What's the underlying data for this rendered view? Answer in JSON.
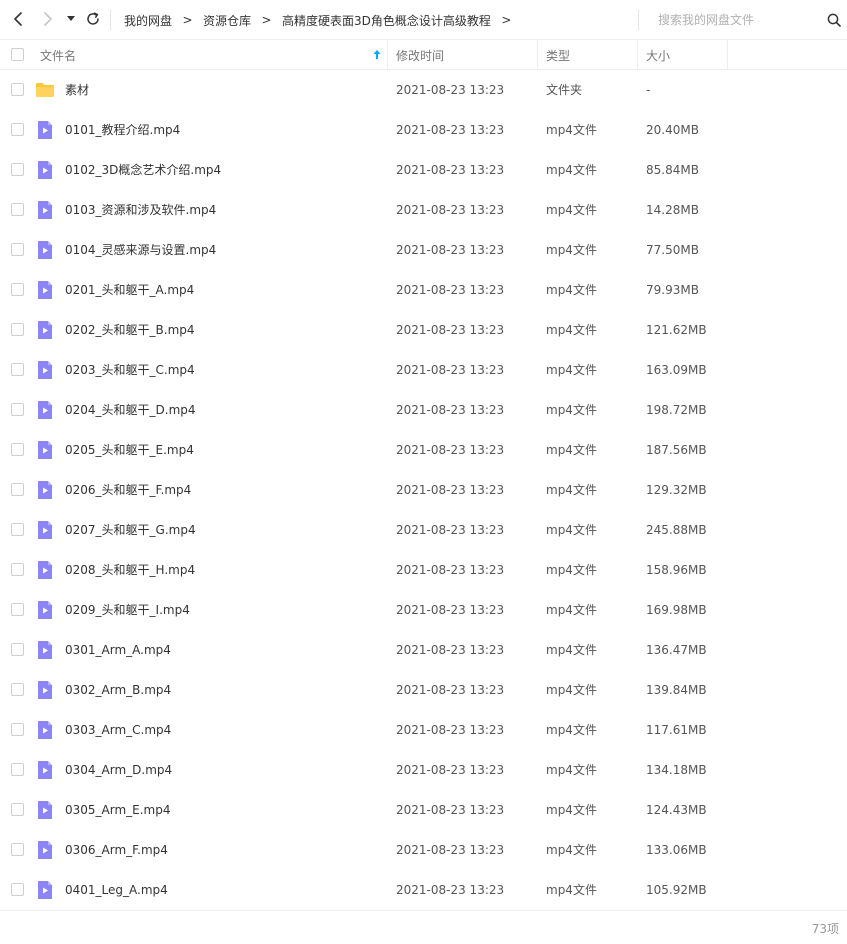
{
  "nav": {
    "back_icon": "chevron-left-icon",
    "forward_icon": "chevron-right-icon",
    "history_icon": "caret-down-icon",
    "refresh_icon": "refresh-icon"
  },
  "breadcrumb": {
    "items": [
      "我的网盘",
      "资源仓库",
      "高精度硬表面3D角色概念设计高级教程"
    ],
    "separator": ">"
  },
  "search": {
    "placeholder": "搜索我的网盘文件",
    "icon": "search-icon"
  },
  "table": {
    "headers": {
      "name": "文件名",
      "modified": "修改时间",
      "type": "类型",
      "size": "大小"
    },
    "sort_indicator_color": "#06a7ff",
    "rows": [
      {
        "name": "素材",
        "date": "2021-08-23 13:23",
        "type": "文件夹",
        "size": "-",
        "icon": "folder-icon"
      },
      {
        "name": "0101_教程介绍.mp4",
        "date": "2021-08-23 13:23",
        "type": "mp4文件",
        "size": "20.40MB",
        "icon": "video-file-icon"
      },
      {
        "name": "0102_3D概念艺术介绍.mp4",
        "date": "2021-08-23 13:23",
        "type": "mp4文件",
        "size": "85.84MB",
        "icon": "video-file-icon"
      },
      {
        "name": "0103_资源和涉及软件.mp4",
        "date": "2021-08-23 13:23",
        "type": "mp4文件",
        "size": "14.28MB",
        "icon": "video-file-icon"
      },
      {
        "name": "0104_灵感来源与设置.mp4",
        "date": "2021-08-23 13:23",
        "type": "mp4文件",
        "size": "77.50MB",
        "icon": "video-file-icon"
      },
      {
        "name": "0201_头和躯干_A.mp4",
        "date": "2021-08-23 13:23",
        "type": "mp4文件",
        "size": "79.93MB",
        "icon": "video-file-icon"
      },
      {
        "name": "0202_头和躯干_B.mp4",
        "date": "2021-08-23 13:23",
        "type": "mp4文件",
        "size": "121.62MB",
        "icon": "video-file-icon"
      },
      {
        "name": "0203_头和躯干_C.mp4",
        "date": "2021-08-23 13:23",
        "type": "mp4文件",
        "size": "163.09MB",
        "icon": "video-file-icon"
      },
      {
        "name": "0204_头和躯干_D.mp4",
        "date": "2021-08-23 13:23",
        "type": "mp4文件",
        "size": "198.72MB",
        "icon": "video-file-icon"
      },
      {
        "name": "0205_头和躯干_E.mp4",
        "date": "2021-08-23 13:23",
        "type": "mp4文件",
        "size": "187.56MB",
        "icon": "video-file-icon"
      },
      {
        "name": "0206_头和躯干_F.mp4",
        "date": "2021-08-23 13:23",
        "type": "mp4文件",
        "size": "129.32MB",
        "icon": "video-file-icon"
      },
      {
        "name": "0207_头和躯干_G.mp4",
        "date": "2021-08-23 13:23",
        "type": "mp4文件",
        "size": "245.88MB",
        "icon": "video-file-icon"
      },
      {
        "name": "0208_头和躯干_H.mp4",
        "date": "2021-08-23 13:23",
        "type": "mp4文件",
        "size": "158.96MB",
        "icon": "video-file-icon"
      },
      {
        "name": "0209_头和躯干_I.mp4",
        "date": "2021-08-23 13:23",
        "type": "mp4文件",
        "size": "169.98MB",
        "icon": "video-file-icon"
      },
      {
        "name": "0301_Arm_A.mp4",
        "date": "2021-08-23 13:23",
        "type": "mp4文件",
        "size": "136.47MB",
        "icon": "video-file-icon"
      },
      {
        "name": "0302_Arm_B.mp4",
        "date": "2021-08-23 13:23",
        "type": "mp4文件",
        "size": "139.84MB",
        "icon": "video-file-icon"
      },
      {
        "name": "0303_Arm_C.mp4",
        "date": "2021-08-23 13:23",
        "type": "mp4文件",
        "size": "117.61MB",
        "icon": "video-file-icon"
      },
      {
        "name": "0304_Arm_D.mp4",
        "date": "2021-08-23 13:23",
        "type": "mp4文件",
        "size": "134.18MB",
        "icon": "video-file-icon"
      },
      {
        "name": "0305_Arm_E.mp4",
        "date": "2021-08-23 13:23",
        "type": "mp4文件",
        "size": "124.43MB",
        "icon": "video-file-icon"
      },
      {
        "name": "0306_Arm_F.mp4",
        "date": "2021-08-23 13:23",
        "type": "mp4文件",
        "size": "133.06MB",
        "icon": "video-file-icon"
      },
      {
        "name": "0401_Leg_A.mp4",
        "date": "2021-08-23 13:23",
        "type": "mp4文件",
        "size": "105.92MB",
        "icon": "video-file-icon"
      }
    ]
  },
  "footer": {
    "count": "73项"
  },
  "colors": {
    "folder": "#ffc63b",
    "video_icon": "#8c86f5",
    "sort_arrow": "#06a7ff"
  }
}
